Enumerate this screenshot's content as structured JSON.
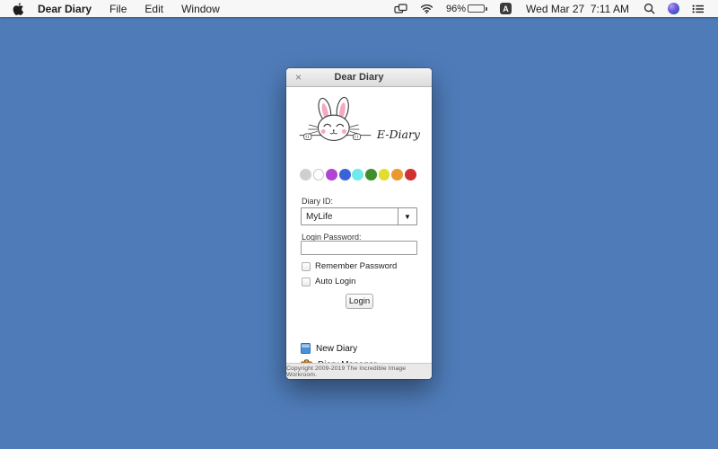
{
  "menu_bar": {
    "app_name": "Dear Diary",
    "menus": [
      "File",
      "Edit",
      "Window"
    ],
    "status": {
      "battery_percent": "96%",
      "input_source_badge": "A",
      "clock": "Wed Mar 27  7:11 AM",
      "icons": [
        "display-mirroring",
        "wifi",
        "battery",
        "input-source",
        "spotlight-search",
        "siri",
        "notification-center"
      ]
    }
  },
  "window": {
    "title": "Dear Diary",
    "close_glyph": "×",
    "logo_caption": "E-Diary",
    "palette": [
      "#cfcfcf",
      "#ffffff",
      "#b244d2",
      "#3b63d8",
      "#70e9e9",
      "#3e8e2e",
      "#e2dc30",
      "#e89a30",
      "#d03030"
    ],
    "form": {
      "diary_id_label": "Diary ID:",
      "diary_id_value": "MyLife",
      "dropdown_arrow": "▼",
      "password_label": "Login Password:",
      "password_value": "",
      "remember_label": "Remember Password",
      "auto_login_label": "Auto Login",
      "login_button": "Login"
    },
    "links": {
      "new_diary": "New Diary",
      "diary_manager": "Diary Manager"
    },
    "footer": "Copyright 2009-2019 The Incredible Image Workroom."
  },
  "colors": {
    "desktop": "#4f7cb9",
    "menubar_bg": "#f7f7f7",
    "window_bg": "#ffffff"
  }
}
